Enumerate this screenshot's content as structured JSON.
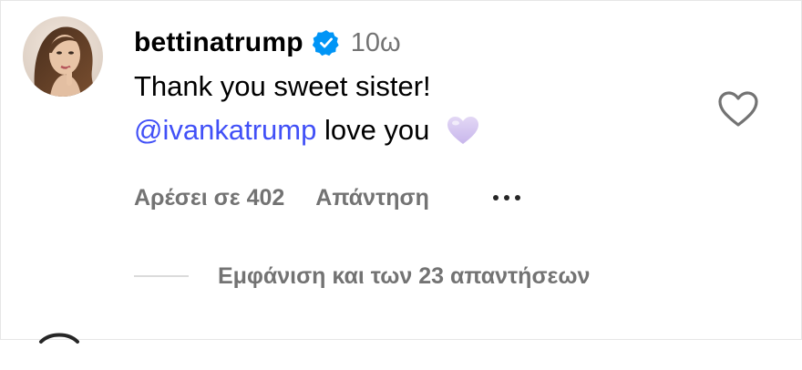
{
  "comment": {
    "username": "bettinatrump",
    "verified": true,
    "timestamp": "10ω",
    "text_line1": "Thank you sweet sister!",
    "mention": "@ivankatrump",
    "text_line2_rest": "love you",
    "emoji": "light-purple-heart"
  },
  "actions": {
    "likes_label": "Αρέσει σε 402",
    "reply_label": "Απάντηση",
    "more_icon": "more-options-icon",
    "like_icon": "heart-outline-icon"
  },
  "replies": {
    "view_label": "Εμφάνιση και των 23 απαντήσεων"
  },
  "colors": {
    "mention": "#4150f7",
    "secondary_text": "#737373",
    "verified_badge": "#0095f6",
    "divider": "#dbdbdb"
  }
}
